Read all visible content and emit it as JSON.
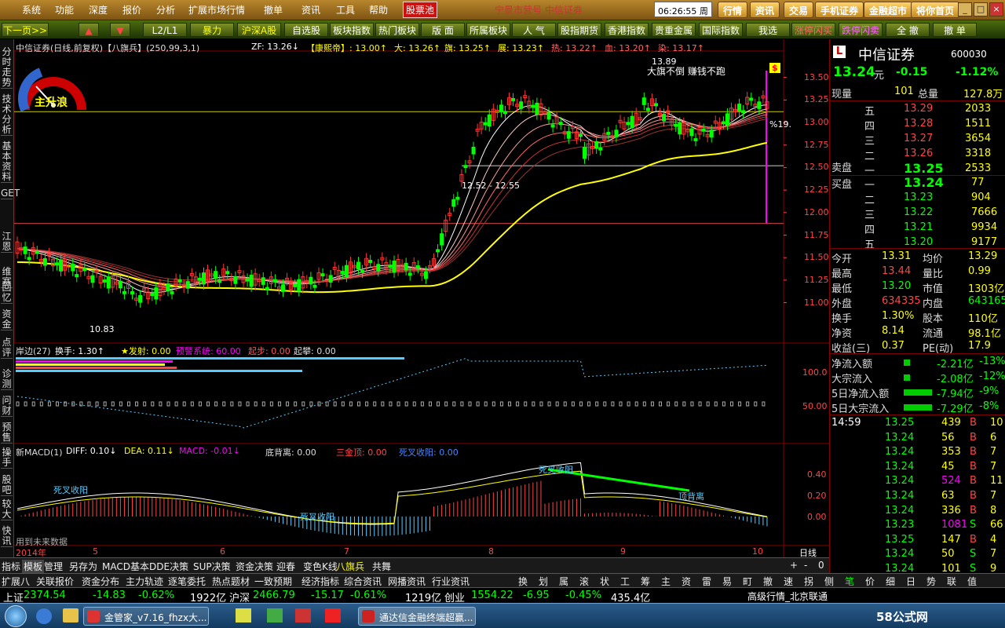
{
  "menu": [
    "系统",
    "功能",
    "深度",
    "报价",
    "分析",
    "扩展市场行情",
    "撤单",
    "资讯",
    "工具",
    "帮助",
    "股票池"
  ],
  "menu_active": "股票池",
  "top_scroll": "宁景市营号  中信证券",
  "clock": "06:26:55 周一",
  "top_buttons": [
    "行情",
    "资讯",
    "交易",
    "手机证券",
    "金融超市",
    "将你首页"
  ],
  "toolbar": [
    "下一页>>",
    "▲",
    "▼",
    "L2/L1",
    "暴力",
    "沪深A股",
    "自选股",
    "板块指数",
    "热门板块",
    "版 面",
    "所属板块",
    "人 气",
    "股指期货",
    "香港指数",
    "贵重金属",
    "国际指数",
    "我选",
    "涨停闪买",
    "跌停闪卖",
    "全 撤",
    "撤 单"
  ],
  "left_strip": [
    "分时走势",
    "技术分析",
    "基本资料",
    "GET",
    "江恩",
    "维赛",
    "回忆",
    "资金",
    "点评",
    "诊测",
    "问财",
    "预售",
    "操手",
    "股吧",
    "较大",
    "快讯"
  ],
  "main_header": {
    "title": "中信证券(日线,前复权)【八旗兵】(250,99,3,1)",
    "zf": "ZF: 13.26↓",
    "kx": "【康熙帝】: 13.00↑",
    "da": "大: 13.26↑",
    "qi": "旗: 13.25↑",
    "zhan": "展: 13.23↑",
    "re": "热: 13.22↑",
    "xue": "血: 13.20↑",
    "ran": "染: 13.17↑"
  },
  "gauge_label": "主升浪",
  "annotations": {
    "high": "13.89",
    "slogan": "大旗不倒 赚钱不跑",
    "range": "12.52 - 12.55",
    "low": "10.83",
    "pct": "%19.",
    "dollar": "$"
  },
  "price_axis": [
    "13.50",
    "13.25",
    "13.00",
    "12.75",
    "12.50",
    "12.25",
    "12.00",
    "11.75",
    "11.50",
    "11.25",
    "11.00"
  ],
  "ind1_header": {
    "name": "岸边(27)",
    "hs": "换手: 1.30↑",
    "fs": "★发射: 0.00",
    "yj": "预警系统: 60.00",
    "qb": "起步: 0.00",
    "qp": "起攀: 0.00"
  },
  "ind1_axis": [
    "100.0",
    "50.00"
  ],
  "ind2_header": {
    "name": "新MACD(1)",
    "diff": "DIFF: 0.10↓",
    "dea": "DEA: 0.11↓",
    "macd": "MACD: -0.01↓",
    "dbl": "底背离: 0.00",
    "sdd": "三金顶: 0.00",
    "scs": "死叉收阳: 0.00"
  },
  "ind2_axis": [
    "0.40",
    "0.20",
    "0.00"
  ],
  "ind2_labels": [
    "死叉收阳",
    "死叉收阳",
    "死叉收阳",
    "顶背离"
  ],
  "future_note": "用到未来数据",
  "date_axis": [
    "2014年",
    "5",
    "6",
    "7",
    "8",
    "9",
    "10"
  ],
  "period": "日线",
  "quote": {
    "name": "中信证券",
    "code": "600030",
    "price": "13.24",
    "unit": "元",
    "chg": "-0.15",
    "pct": "-1.12%",
    "xl_label": "现量",
    "xl": "101",
    "zl_label": "总量",
    "zl": "127.8万",
    "asks": [
      [
        "五",
        "13.29",
        "2033"
      ],
      [
        "四",
        "13.28",
        "1511"
      ],
      [
        "三",
        "13.27",
        "3654"
      ],
      [
        "二",
        "13.26",
        "3318"
      ],
      [
        "一",
        "13.25",
        "2533"
      ]
    ],
    "ask_label": "卖盘",
    "bid_label": "买盘",
    "bids": [
      [
        "一",
        "13.24",
        "77"
      ],
      [
        "二",
        "13.23",
        "904"
      ],
      [
        "三",
        "13.22",
        "7666"
      ],
      [
        "四",
        "13.21",
        "9934"
      ],
      [
        "五",
        "13.20",
        "9177"
      ]
    ],
    "stats": [
      [
        "今开",
        "13.31",
        "均价",
        "13.29"
      ],
      [
        "最高",
        "13.44",
        "量比",
        "0.99"
      ],
      [
        "最低",
        "13.20",
        "市值",
        "1303亿"
      ],
      [
        "外盘",
        "634335",
        "内盘",
        "643165"
      ],
      [
        "换手",
        "1.30%",
        "股本",
        "110亿"
      ],
      [
        "净资",
        "8.14",
        "流通",
        "98.1亿"
      ],
      [
        "收益(三)",
        "0.37",
        "PE(动)",
        "17.9"
      ]
    ],
    "flows": [
      [
        "净流入额",
        "-2.21亿",
        "-13%"
      ],
      [
        "大宗流入",
        "-2.08亿",
        "-12%"
      ],
      [
        "5日净流入额",
        "-7.94亿",
        "-9%"
      ],
      [
        "5日大宗流入",
        "-7.29亿",
        "-8%"
      ]
    ],
    "ticks": [
      [
        "14:59",
        "13.25",
        "439",
        "B",
        "10"
      ],
      [
        "",
        "13.24",
        "56",
        "B",
        "6"
      ],
      [
        "",
        "13.24",
        "353",
        "B",
        "7"
      ],
      [
        "",
        "13.24",
        "45",
        "B",
        "7"
      ],
      [
        "",
        "13.24",
        "524",
        "B",
        "11"
      ],
      [
        "",
        "13.24",
        "63",
        "B",
        "7"
      ],
      [
        "",
        "13.24",
        "336",
        "B",
        "8"
      ],
      [
        "",
        "13.23",
        "1081",
        "S",
        "66"
      ],
      [
        "",
        "13.25",
        "147",
        "B",
        "4"
      ],
      [
        "",
        "13.24",
        "50",
        "S",
        "7"
      ],
      [
        "",
        "13.24",
        "101",
        "S",
        "9"
      ]
    ]
  },
  "bottom_tabs": [
    "指标",
    "模板",
    "管理",
    "另存为",
    "MACD基本",
    "DDE决策",
    "SUP决策",
    "资金决策",
    "迎春",
    "变色K线",
    "八旗兵",
    "共舞"
  ],
  "period_tabs": [
    "+",
    "-",
    "0"
  ],
  "bottom_tabs2": [
    "扩展八",
    "关联报价",
    "资金分布",
    "主力轨迹",
    "逐笔委托",
    "热点题材",
    "一致预期",
    "经济指标",
    "综合资讯",
    "网播资讯",
    "行业资讯"
  ],
  "right_tabs": [
    "换",
    "划",
    "属",
    "滚",
    "状",
    "工",
    "筹",
    "主",
    "资",
    "雷",
    "易",
    "町",
    "撤",
    "速",
    "拐",
    "侧",
    "笔",
    "价",
    "细",
    "日",
    "势",
    "联",
    "值"
  ],
  "status": {
    "sh_label": "上证",
    "sh": "2374.54",
    "sh_chg": "-14.83",
    "sh_pct": "-0.62%",
    "sh_amt": "1922亿",
    "hs_label": "沪深",
    "hs": "2466.79",
    "hs_chg": "-15.17",
    "hs_pct": "-0.61%",
    "hs_amt": "1219亿",
    "cy_label": "创业",
    "cy": "1554.22",
    "cy_chg": "-6.95",
    "cy_pct": "-0.45%",
    "cy_amt": "435.4亿",
    "feed": "高级行情_北京联通",
    "brand": "58公式网"
  },
  "taskbar": [
    "金管家_v7.16_fhzx大...",
    "通达信金融终端超赢..."
  ],
  "chart_data": {
    "type": "candlestick",
    "title": "中信证券(日线,前复权)【八旗兵】(250,99,3,1)",
    "ylim": [
      10.7,
      13.75
    ],
    "y_ticks": [
      11.0,
      11.25,
      11.5,
      11.75,
      12.0,
      12.25,
      12.5,
      12.75,
      13.0,
      13.25,
      13.5
    ],
    "high_mark": 13.89,
    "low_mark": 10.83,
    "hlines": [
      13.12,
      12.52,
      11.88
    ]
  }
}
